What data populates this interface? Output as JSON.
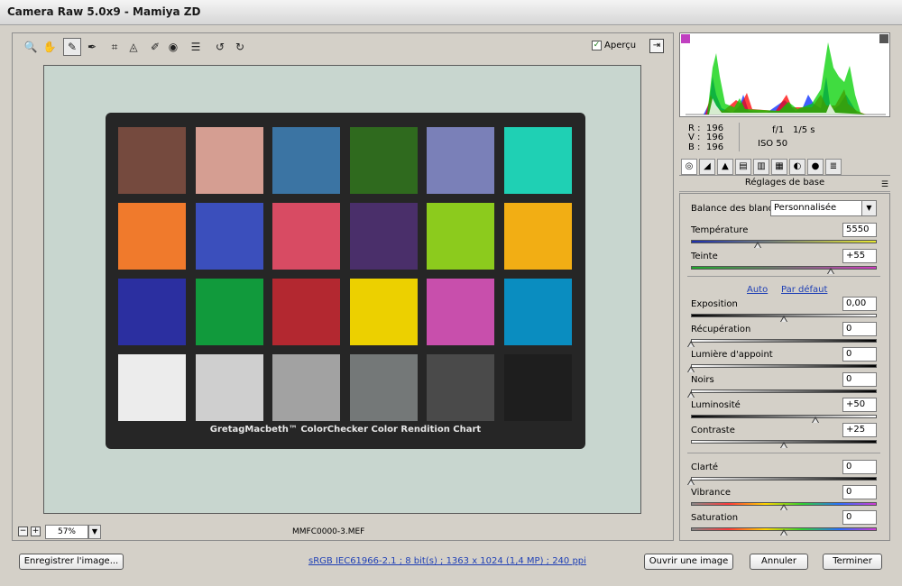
{
  "window": {
    "title": "Camera Raw 5.0x9  -  Mamiya ZD"
  },
  "toolbar": {
    "tools": [
      {
        "name": "zoom-tool",
        "icon": "zoom-icon",
        "glyph": "🔍"
      },
      {
        "name": "hand-tool",
        "icon": "hand-icon",
        "glyph": "✋"
      },
      {
        "name": "white-balance-tool",
        "icon": "eyedropper-icon",
        "glyph": "✎"
      },
      {
        "name": "color-sampler-tool",
        "icon": "color-sampler-icon",
        "glyph": "✒"
      },
      {
        "name": "crop-tool",
        "icon": "crop-icon",
        "glyph": "⌗"
      },
      {
        "name": "straighten-tool",
        "icon": "straighten-icon",
        "glyph": "◬"
      },
      {
        "name": "retouch-tool",
        "icon": "brush-icon",
        "glyph": "✐"
      },
      {
        "name": "red-eye-tool",
        "icon": "red-eye-icon",
        "glyph": "◉"
      },
      {
        "name": "preferences-tool",
        "icon": "list-icon",
        "glyph": "☰"
      },
      {
        "name": "rotate-left-tool",
        "icon": "rotate-left-icon",
        "glyph": "↺"
      },
      {
        "name": "rotate-right-tool",
        "icon": "rotate-right-icon",
        "glyph": "↻"
      }
    ],
    "preview_label": "Aperçu",
    "preview_checked": "✓",
    "fullscreen_glyph": "⇥"
  },
  "canvas": {
    "chart_caption": "GretagMacbeth™ ColorChecker Color Rendition Chart",
    "patch_colors": [
      "#754a3e",
      "#d59e92",
      "#3b74a3",
      "#2f6a1e",
      "#7a80b8",
      "#1fd0b4",
      "#f07a2c",
      "#3b4fbc",
      "#d84b63",
      "#4a2f6a",
      "#8ccb1d",
      "#f2ae14",
      "#2b2fa0",
      "#119a3c",
      "#b32830",
      "#ecd000",
      "#c84fac",
      "#0a8dc0",
      "#ececec",
      "#cfcfcf",
      "#a2a2a2",
      "#747878",
      "#4a4a4a",
      "#1e1e1e"
    ]
  },
  "statusbar": {
    "zoom_out": "−",
    "zoom_in": "+",
    "zoom_value": "57%",
    "filename": "MMFC0000-3.MEF"
  },
  "info": {
    "r_label": "R :",
    "r_value": "196",
    "v_label": "V :",
    "v_value": "196",
    "b_label": "B :",
    "b_value": "196",
    "aperture": "f/1",
    "shutter": "1/5 s",
    "iso": "ISO 50"
  },
  "panel": {
    "tabs": [
      {
        "name": "tab-basic",
        "icon": "aperture-icon",
        "glyph": "◎"
      },
      {
        "name": "tab-tone-curve",
        "icon": "tone-curve-icon",
        "glyph": "◢"
      },
      {
        "name": "tab-detail",
        "icon": "detail-icon",
        "glyph": "▲"
      },
      {
        "name": "tab-hsl",
        "icon": "hsl-icon",
        "glyph": "▤"
      },
      {
        "name": "tab-split-toning",
        "icon": "split-toning-icon",
        "glyph": "▥"
      },
      {
        "name": "tab-lens",
        "icon": "lens-icon",
        "glyph": "▦"
      },
      {
        "name": "tab-calibration",
        "icon": "calibration-icon",
        "glyph": "◐"
      },
      {
        "name": "tab-camera",
        "icon": "camera-icon",
        "glyph": "●"
      },
      {
        "name": "tab-presets",
        "icon": "presets-icon",
        "glyph": "≣"
      }
    ],
    "title": "Réglages de base",
    "menu_glyph": "☰",
    "wb_label": "Balance des blancs :",
    "wb_value": "Personnalisée",
    "wb_drop": "▼",
    "auto_label": "Auto",
    "default_label": "Par défaut",
    "sliders": [
      {
        "name": "temperature",
        "label": "Température",
        "value": "5550",
        "pos": 0.36,
        "track": "linear-gradient(90deg,#1d2fb0,#e8e830)"
      },
      {
        "name": "tint",
        "label": "Teinte",
        "value": "+55",
        "pos": 0.75,
        "track": "linear-gradient(90deg,#1eaa2a,#d03cc0)"
      },
      {
        "name": "exposure",
        "label": "Exposition",
        "value": "0,00",
        "pos": 0.5,
        "track": "linear-gradient(90deg,#000,#fff)"
      },
      {
        "name": "recovery",
        "label": "Récupération",
        "value": "0",
        "pos": 0.0,
        "track": "linear-gradient(90deg,#fff,#000)"
      },
      {
        "name": "fill-light",
        "label": "Lumière d'appoint",
        "value": "0",
        "pos": 0.0,
        "track": "linear-gradient(90deg,#fff,#000)"
      },
      {
        "name": "blacks",
        "label": "Noirs",
        "value": "0",
        "pos": 0.0,
        "track": "linear-gradient(90deg,#fff,#000)"
      },
      {
        "name": "brightness",
        "label": "Luminosité",
        "value": "+50",
        "pos": 0.67,
        "track": "linear-gradient(90deg,#000,#fff)"
      },
      {
        "name": "contrast",
        "label": "Contraste",
        "value": "+25",
        "pos": 0.5,
        "track": "linear-gradient(90deg,#fff,#000)"
      },
      {
        "name": "clarity",
        "label": "Clarté",
        "value": "0",
        "pos": 0.0,
        "track": "linear-gradient(90deg,#fff,#000)"
      },
      {
        "name": "vibrance",
        "label": "Vibrance",
        "value": "0",
        "pos": 0.5,
        "track": "linear-gradient(90deg,#888,#ff3b3b,#ffd500,#30d030,#2b6fff,#d23cd2)"
      },
      {
        "name": "saturation",
        "label": "Saturation",
        "value": "0",
        "pos": 0.5,
        "track": "linear-gradient(90deg,#888,#ff3b3b,#ffd500,#30d030,#2b6fff,#d23cd2)"
      }
    ]
  },
  "bottom": {
    "save_label": "Enregistrer l'image...",
    "workflow_label": "sRGB IEC61966-2.1 ; 8 bit(s) ; 1363 x 1024 (1,4 MP) ; 240 ppi",
    "open_label": "Ouvrir une image",
    "cancel_label": "Annuler",
    "done_label": "Terminer"
  }
}
